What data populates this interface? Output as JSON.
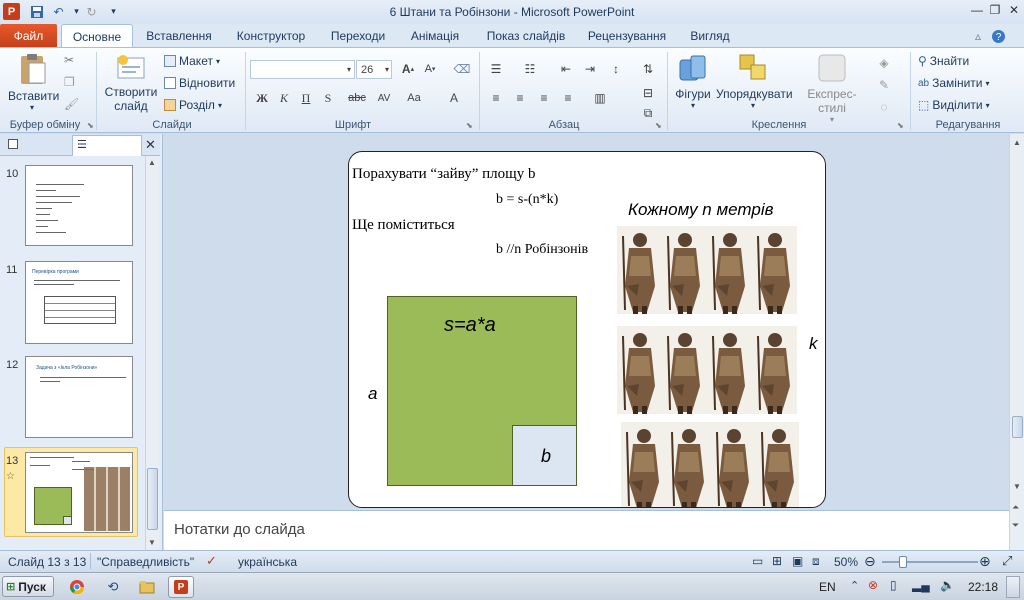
{
  "window": {
    "title": "6 Штани та Робінзони  -  Microsoft PowerPoint"
  },
  "tabs": [
    {
      "label": "Файл"
    },
    {
      "label": "Основне"
    },
    {
      "label": "Вставлення"
    },
    {
      "label": "Конструктор"
    },
    {
      "label": "Переходи"
    },
    {
      "label": "Анімація"
    },
    {
      "label": "Показ слайдів"
    },
    {
      "label": "Рецензування"
    },
    {
      "label": "Вигляд"
    }
  ],
  "ribbon": {
    "clipboard": {
      "paste": "Вставити",
      "label": "Буфер обміну"
    },
    "slides": {
      "new_slide_1": "Створити",
      "new_slide_2": "слайд",
      "layout": "Макет",
      "reset": "Відновити",
      "section": "Розділ",
      "label": "Слайди"
    },
    "font": {
      "font_name": "",
      "font_size": "26",
      "label": "Шрифт"
    },
    "paragraph": {
      "label": "Абзац"
    },
    "drawing": {
      "shapes": "Фігури",
      "arrange": "Упорядкувати",
      "quick_styles": "Експрес-стилі",
      "label": "Креслення"
    },
    "editing": {
      "find": "Знайти",
      "replace": "Замінити",
      "select": "Виділити",
      "label": "Редагування"
    }
  },
  "thumbnails": [
    {
      "number": "10"
    },
    {
      "number": "11",
      "title": "Перевірка програми"
    },
    {
      "number": "12",
      "title": "Задача з «Ікла Робінзони»"
    },
    {
      "number": "13"
    }
  ],
  "slide": {
    "line1": "Порахувати “зайву” площу b",
    "formula1": "b = s-(n*k)",
    "line2": "Ще поміститься",
    "formula2": "b //n Робінзонів",
    "caption": "Кожному n метрів",
    "area_formula": "s=a*a",
    "side_a": "a",
    "side_b": "b",
    "side_k": "k",
    "colors": {
      "green_square": "#9bbb59",
      "blue_square": "#dce6f2"
    }
  },
  "notes": {
    "placeholder": "Нотатки до слайда"
  },
  "status": {
    "slide_counter": "Слайд 13 з 13",
    "theme": "\"Справедливість\"",
    "language": "українська",
    "zoom": "50%"
  },
  "taskbar": {
    "start": "Пуск",
    "lang": "EN",
    "time": "22:18"
  }
}
